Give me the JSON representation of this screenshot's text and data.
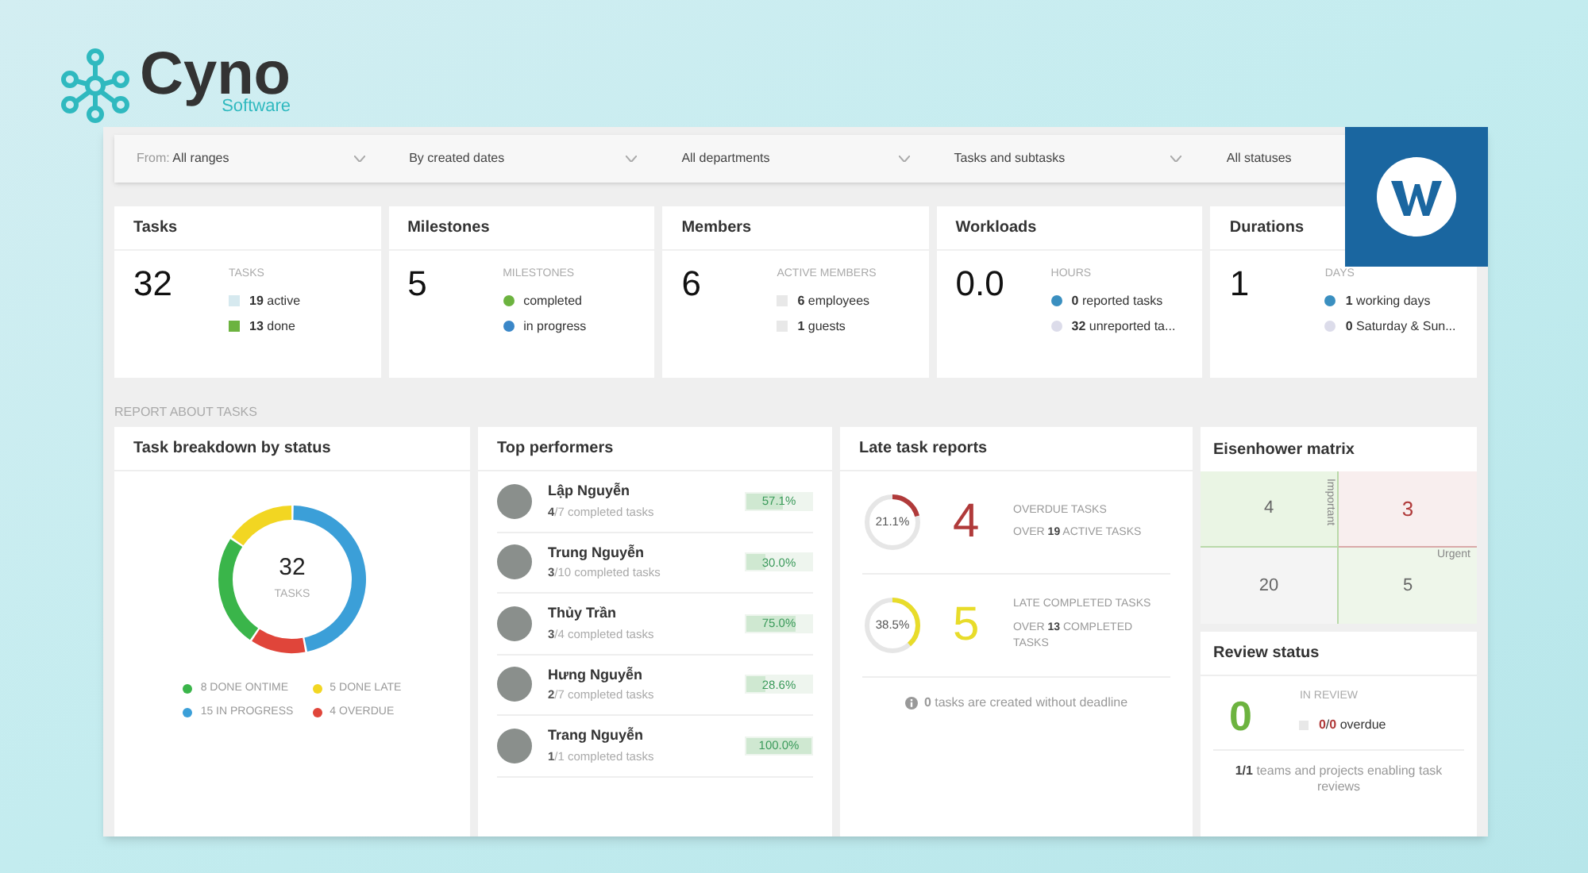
{
  "brand": {
    "name": "Cyno",
    "tagline": "Software"
  },
  "filters": [
    {
      "prefix": "From:",
      "value": "All ranges"
    },
    {
      "value": "By created dates"
    },
    {
      "value": "All departments"
    },
    {
      "value": "Tasks and subtasks"
    },
    {
      "value": "All statuses"
    }
  ],
  "stat_cards": [
    {
      "title": "Tasks",
      "value": "32",
      "caption": "TASKS",
      "items": [
        {
          "kind": "square",
          "color": "#d6e9ef",
          "text": "**19** active"
        },
        {
          "kind": "square",
          "color": "#6cb33f",
          "text": "**13** done"
        }
      ]
    },
    {
      "title": "Milestones",
      "value": "5",
      "caption": "MILESTONES",
      "items": [
        {
          "kind": "dot",
          "color": "#6cb33f",
          "text": "completed"
        },
        {
          "kind": "dot",
          "color": "#3a87c8",
          "text": "in progress"
        }
      ]
    },
    {
      "title": "Members",
      "value": "6",
      "caption": "ACTIVE MEMBERS",
      "items": [
        {
          "kind": "square",
          "color": "#e8e8e8",
          "text": "**6** employees"
        },
        {
          "kind": "square",
          "color": "#e8e8e8",
          "text": "**1** guests"
        }
      ]
    },
    {
      "title": "Workloads",
      "value": "0.0",
      "caption": "HOURS",
      "items": [
        {
          "kind": "dot",
          "color": "#3a8fc0",
          "text": "**0** reported tasks"
        },
        {
          "kind": "dot",
          "color": "#dcdcea",
          "text": "**32** unreported ta..."
        }
      ]
    },
    {
      "title": "Durations",
      "value": "1",
      "caption": "DAYS",
      "items": [
        {
          "kind": "dot",
          "color": "#3a8fc0",
          "text": "**1** working days"
        },
        {
          "kind": "dot",
          "color": "#dcdcea",
          "text": "**0** Saturday & Sun..."
        }
      ]
    }
  ],
  "section_label": "REPORT ABOUT TASKS",
  "breakdown": {
    "title": "Task breakdown by status",
    "total": "32",
    "total_label": "TASKS",
    "chart_data": {
      "type": "donut",
      "categories": [
        "8 DONE ONTIME",
        "5 DONE LATE",
        "15 IN PROGRESS",
        "4 OVERDUE"
      ],
      "values": [
        8,
        5,
        15,
        4
      ]
    },
    "legend": [
      {
        "color": "#3ab54a"
      },
      {
        "color": "#f2d622"
      },
      {
        "color": "#3b9fd8"
      },
      {
        "color": "#e0453a"
      }
    ]
  },
  "performers": {
    "title": "Top performers",
    "rows": [
      {
        "name": "Lập Nguyễn",
        "detail": "**4**/7 completed tasks",
        "percent": "57.1%",
        "level": 0.571
      },
      {
        "name": "Trung Nguyễn",
        "detail": "**3**/10 completed tasks",
        "percent": "30.0%",
        "level": 0.3
      },
      {
        "name": "Thủy Trần",
        "detail": "**3**/4 completed tasks",
        "percent": "75.0%",
        "level": 0.75
      },
      {
        "name": "Hưng Nguyễn",
        "detail": "**2**/7 completed tasks",
        "percent": "28.6%",
        "level": 0.286
      },
      {
        "name": "Trang Nguyễn",
        "detail": "**1**/1 completed tasks",
        "percent": "100.0%",
        "level": 1
      }
    ]
  },
  "late_reports": {
    "title": "Late task reports",
    "gauges": [
      {
        "percent": "21.1%",
        "level": 0.211,
        "color": "#b03a3a",
        "count": "4",
        "line1": "OVERDUE TASKS",
        "line2": "OVER **19** ACTIVE TASKS"
      },
      {
        "percent": "38.5%",
        "level": 0.385,
        "color": "#e8dc2a",
        "count": "5",
        "line1": "LATE COMPLETED TASKS",
        "line2": "OVER **13** COMPLETED TASKS"
      }
    ],
    "note": "**0** tasks are created without deadline"
  },
  "eisenhower": {
    "title": "Eisenhower matrix",
    "cells": [
      "4",
      "3",
      "20",
      "5"
    ],
    "axis_y": "Important",
    "axis_x": "Urgent"
  },
  "review": {
    "title": "Review status",
    "value": "0",
    "caption": "IN REVIEW",
    "overdue": "**0**/**0** overdue",
    "footer": "**1/1** teams and projects enabling task reviews"
  }
}
